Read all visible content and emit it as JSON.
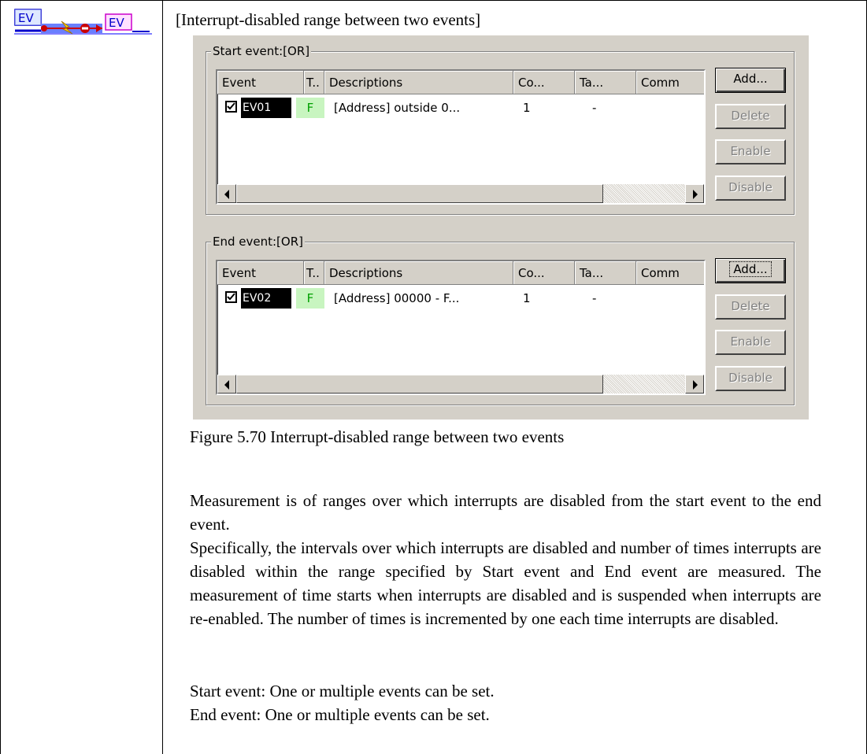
{
  "icon": {
    "left_label": "EV",
    "right_label": "EV",
    "semantic": "interrupt-disabled-range-icon"
  },
  "section_title": "[Interrupt-disabled range between two events]",
  "dialog": {
    "columns": [
      "Event",
      "T..",
      "Descriptions",
      "Co...",
      "Ta...",
      "Comm"
    ],
    "start_group": {
      "legend": "Start event:[OR]",
      "row": {
        "checked": true,
        "event": "EV01",
        "type": "F",
        "description": "[Address] outside 0...",
        "count": "1",
        "target": "-"
      },
      "buttons": {
        "add": "Add...",
        "delete": "Delete",
        "enable": "Enable",
        "disable": "Disable"
      }
    },
    "end_group": {
      "legend": "End event:[OR]",
      "row": {
        "checked": true,
        "event": "EV02",
        "type": "F",
        "description": "[Address] 00000 - F...",
        "count": "1",
        "target": "-"
      },
      "buttons": {
        "add": "Add...",
        "delete": "Delete",
        "enable": "Enable",
        "disable": "Disable"
      }
    },
    "colors": {
      "face": "#d4d0c8",
      "type_bg": "#c8f5c0",
      "type_fg": "#00a000"
    }
  },
  "caption": "Figure 5.70 Interrupt-disabled range between two events",
  "paragraphs": [
    "Measurement is of ranges over which interrupts are disabled from the start event to the end event.",
    "Specifically, the intervals over which interrupts are disabled and number of times interrupts are disabled within the range specified by Start event and End event are measured. The measurement of time starts when interrupts are disabled and is suspended when interrupts are re-enabled. The number of times is incremented by one each time interrupts are disabled.",
    "Start event: One or multiple events can be set.",
    "End event: One or multiple events can be set."
  ]
}
